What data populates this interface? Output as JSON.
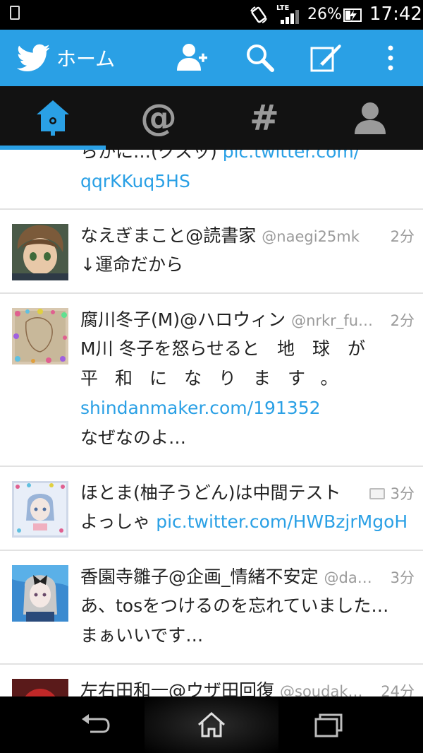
{
  "status_bar": {
    "network": "LTE",
    "battery_percent": "26%",
    "time": "17:42"
  },
  "action_bar": {
    "title": "ホーム",
    "icons": [
      "twitter-bird-icon",
      "add-user-icon",
      "search-icon",
      "compose-icon",
      "overflow-menu-icon"
    ]
  },
  "tabs": [
    {
      "name": "home",
      "icon": "home-icon",
      "selected": true
    },
    {
      "name": "mentions",
      "label": "@",
      "selected": false
    },
    {
      "name": "discover",
      "label": "#",
      "selected": false
    },
    {
      "name": "profile",
      "icon": "profile-icon",
      "selected": false
    }
  ],
  "colors": {
    "accent": "#2aa0e5",
    "tab_bar": "#121212",
    "text": "#222222",
    "meta": "#9a9a9a"
  },
  "timeline": {
    "partial_top": {
      "text_cut": "らかに…(クスッ) ",
      "link_cut": "pic.twitter.com/",
      "link_line2": "qqrKKuq5HS"
    },
    "tweets": [
      {
        "name": "なえぎまこと@読書家",
        "handle": "@naegi25mk",
        "time": "2分",
        "text": "↓運命だから"
      },
      {
        "name": "腐川冬子(M)@ハロウィン",
        "handle": "@nrkr_fu…",
        "time": "2分",
        "text_line1": "M川 冬子を怒らせると　地　球　が",
        "text_line2": "平和になります。",
        "link": "shindanmaker.com/191352",
        "text_line4": "なぜなのよ…"
      },
      {
        "name": "ほとま(柚子うどん)は中間テスト",
        "handle": "",
        "time": "3分",
        "has_media": true,
        "text": "よっしゃ ",
        "link": "pic.twitter.com/HWBzjrMgoH"
      },
      {
        "name": "香園寺雛子@企画_情緒不安定",
        "handle": "@da…",
        "time": "3分",
        "text_line1": "あ、tosをつけるのを忘れていました…",
        "text_line2": "まぁいいです…"
      },
      {
        "name": "左右田和一@ウザ田回復",
        "handle": "@soudak…",
        "time": "24分"
      }
    ]
  }
}
